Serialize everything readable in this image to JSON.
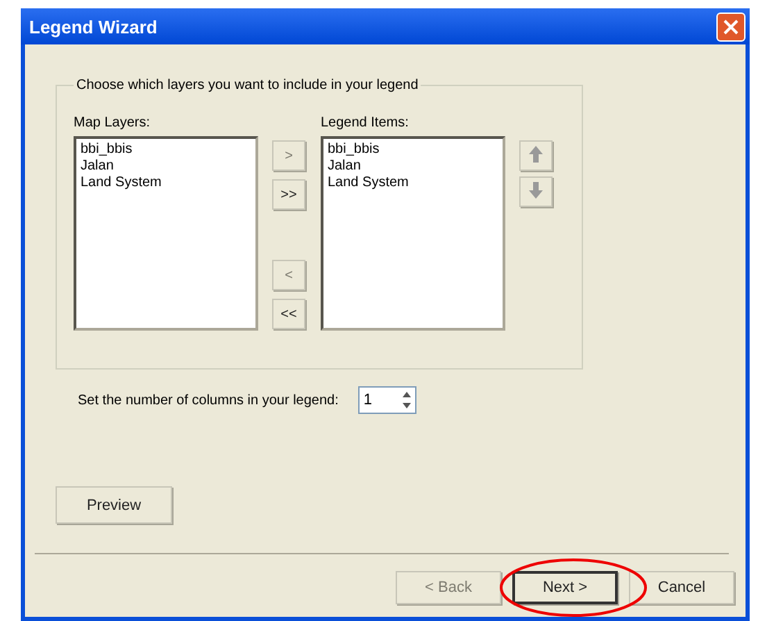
{
  "window": {
    "title": "Legend Wizard"
  },
  "group": {
    "label": "Choose which layers you want to include in your legend"
  },
  "map_layers": {
    "label": "Map Layers:",
    "items": [
      "bbi_bbis",
      "Jalan",
      "Land System"
    ]
  },
  "legend_items": {
    "label": "Legend Items:",
    "items": [
      "bbi_bbis",
      "Jalan",
      "Land System"
    ]
  },
  "transfer_buttons": [
    {
      "label": ">",
      "disabled": true
    },
    {
      "label": ">>",
      "disabled": false
    },
    {
      "label": "<",
      "disabled": true
    },
    {
      "label": "<<",
      "disabled": false
    }
  ],
  "columns": {
    "label": "Set the number of columns in your legend:",
    "value": "1"
  },
  "preview_button": {
    "label": "Preview"
  },
  "nav_buttons": [
    {
      "label": "< Back",
      "disabled": true,
      "highlighted": false
    },
    {
      "label": "Next >",
      "disabled": false,
      "highlighted": true
    },
    {
      "label": "Cancel",
      "disabled": false,
      "highlighted": false
    }
  ]
}
